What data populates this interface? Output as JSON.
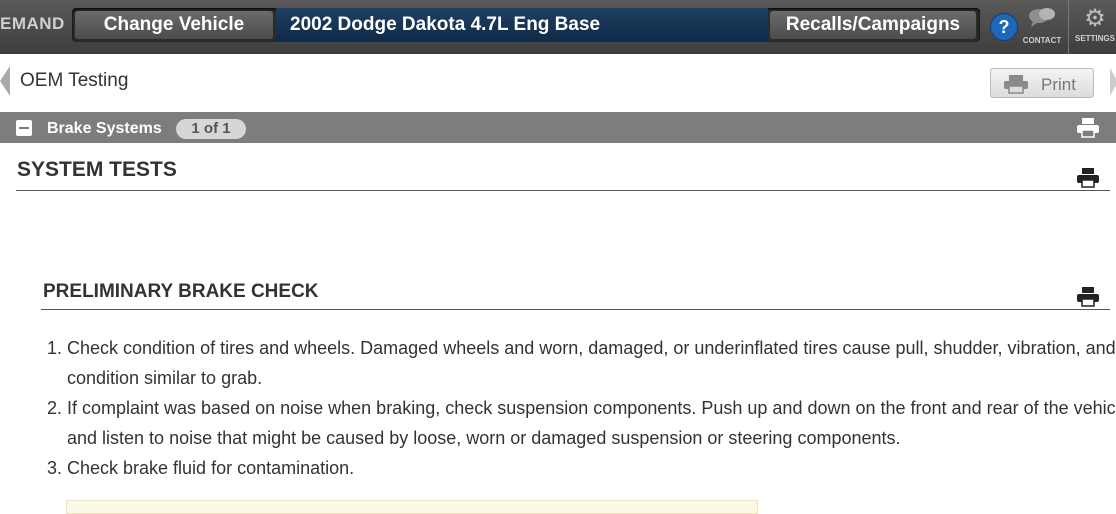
{
  "topbar": {
    "brand": "EMAND",
    "change_vehicle": "Change Vehicle",
    "vehicle": "2002 Dodge Dakota 4.7L Eng Base",
    "recalls": "Recalls/Campaigns",
    "help": "?",
    "contact_label": "CONTACT",
    "settings_label": "SETTINGS"
  },
  "subheader": {
    "title": "OEM Testing",
    "print_label": "Print"
  },
  "section_bar": {
    "title": "Brake Systems",
    "pager": "1 of 1"
  },
  "content": {
    "heading": "SYSTEM TESTS",
    "subheading": "PRELIMINARY BRAKE CHECK",
    "steps": [
      "Check condition of tires and wheels. Damaged wheels and worn, damaged, or underinflated tires cause pull, shudder, vibration, and a condition similar to grab.",
      "If complaint was based on noise when braking, check suspension components. Push up and down on the front and rear of the vehicle and listen to noise that might be caused by loose, worn or damaged suspension or steering components.",
      "Check brake fluid for contamination."
    ]
  },
  "icons": {
    "help": "help-icon",
    "contact": "chat-bubbles-icon",
    "settings": "gear-icon",
    "print": "printer-icon",
    "collapse": "minus-icon"
  },
  "colors": {
    "topbar": "#4a4a4a",
    "vehicle_bar": "#163556",
    "section_bar": "#7d7d7d",
    "help": "#1f67b8"
  }
}
